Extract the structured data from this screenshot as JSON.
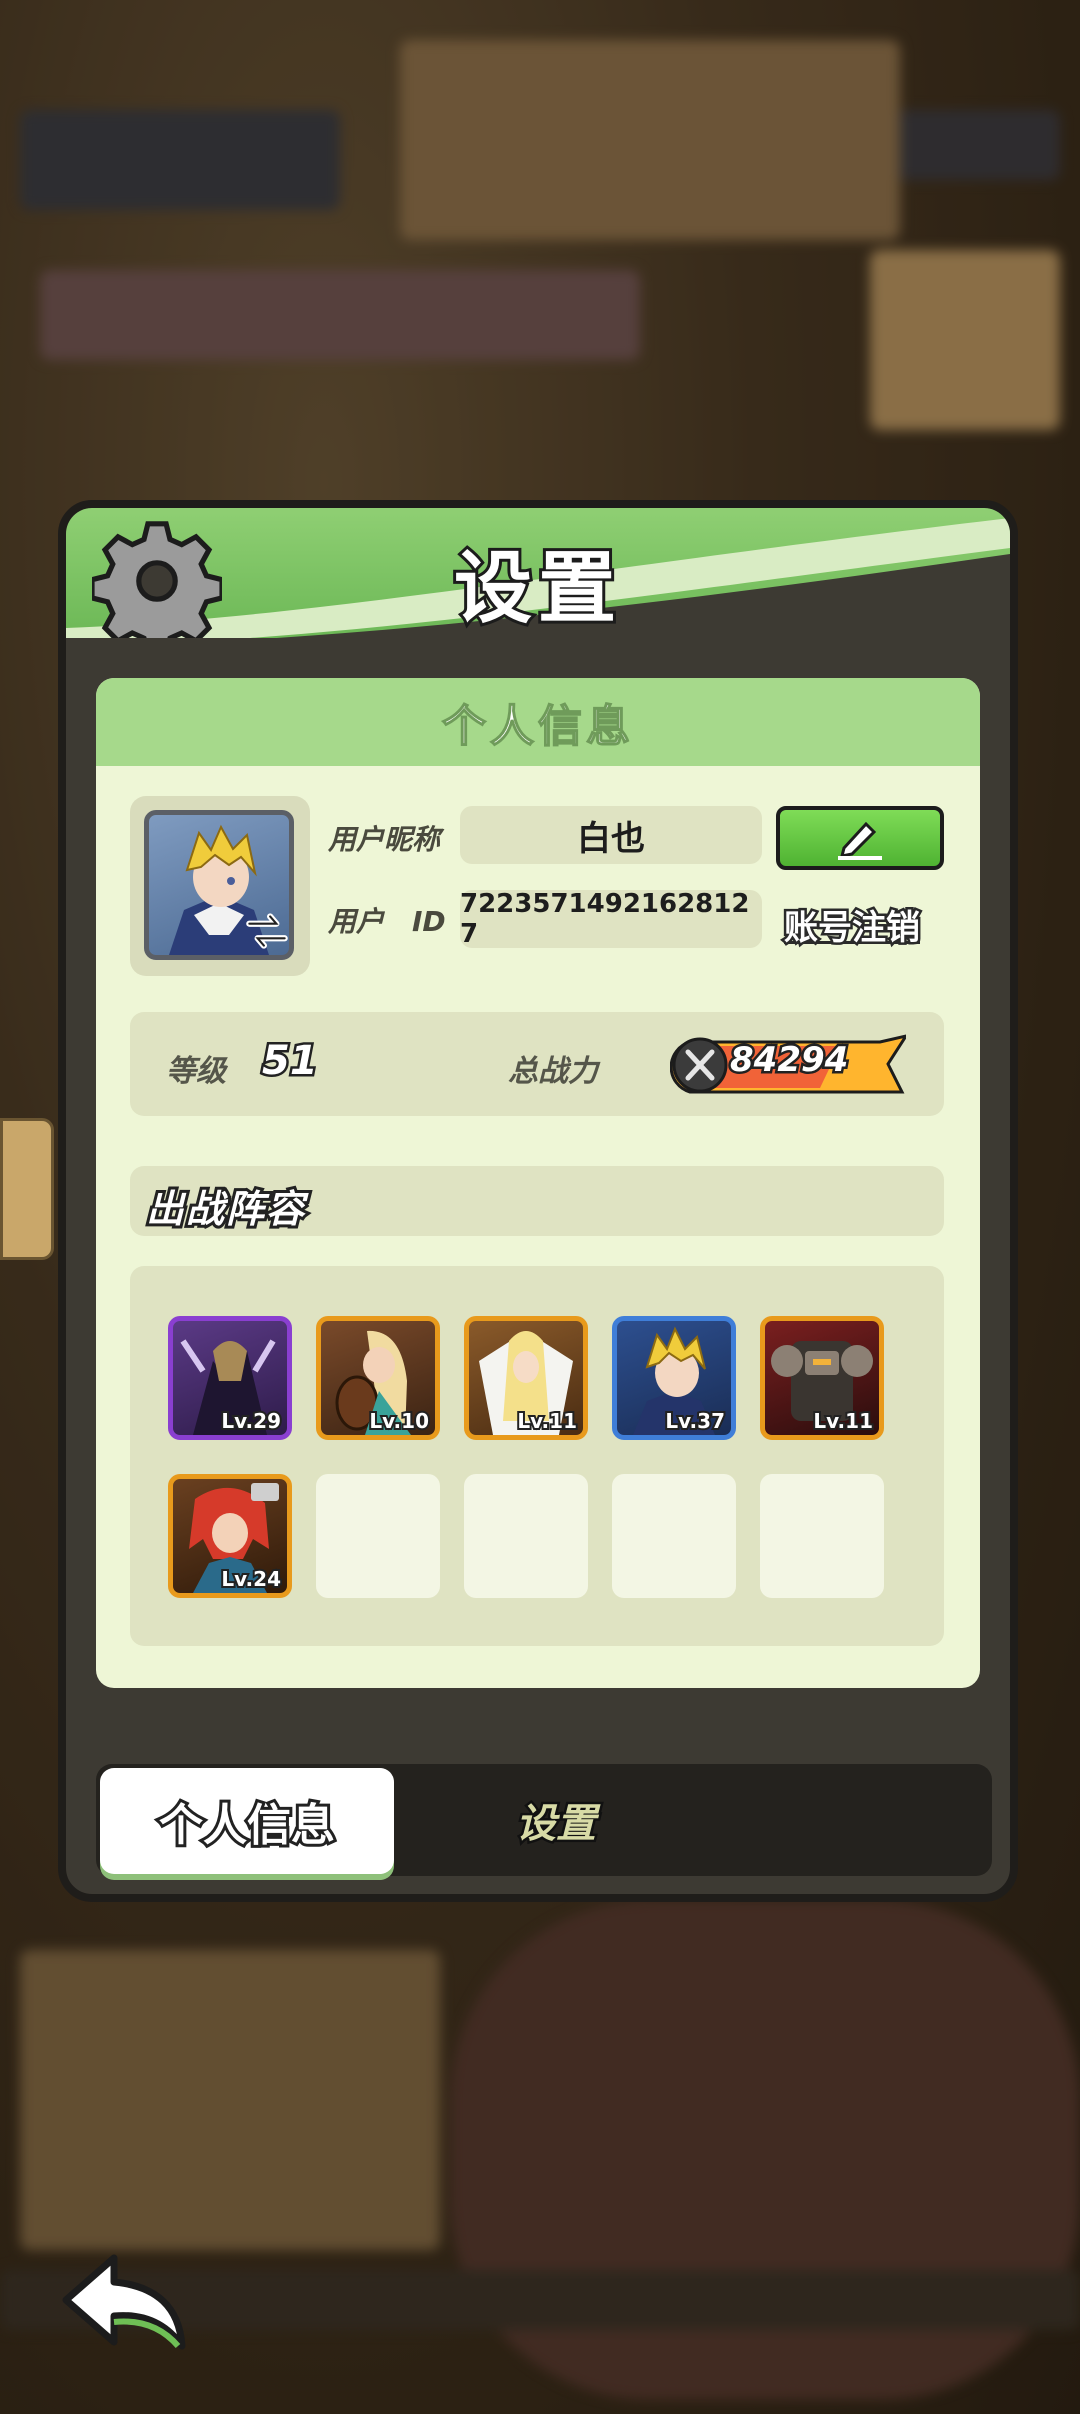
{
  "header": {
    "title": "设置"
  },
  "profile": {
    "section_title": "个人信息",
    "nickname_label": "用户昵称",
    "nickname_value": "白也",
    "user_id_label": "用户　ID",
    "user_id_value": "7223571492162812​7",
    "delete_account_label": "账号注销",
    "level_label": "等级",
    "level_value": "51",
    "power_label": "总战力",
    "power_value": "84294"
  },
  "lineup": {
    "title": "出战阵容",
    "heroes": [
      {
        "level": "Lv.29",
        "frame_color": "#8a3fd0"
      },
      {
        "level": "Lv.10",
        "frame_color": "#e89a1c"
      },
      {
        "level": "Lv.11",
        "frame_color": "#e89a1c"
      },
      {
        "level": "Lv.37",
        "frame_color": "#3f7ed8"
      },
      {
        "level": "Lv.11",
        "frame_color": "#e89a1c"
      },
      {
        "level": "Lv.24",
        "frame_color": "#e89a1c"
      }
    ]
  },
  "tabs": {
    "personal_info": "个人信息",
    "settings": "设置"
  },
  "colors": {
    "accent_green": "#8fcf73",
    "panel_dark": "#3d3a33",
    "card_bg": "#eef6d6"
  },
  "icons": [
    "gear-icon",
    "pencil-icon",
    "swap-icon",
    "sword-power-icon",
    "back-arrow-icon"
  ]
}
